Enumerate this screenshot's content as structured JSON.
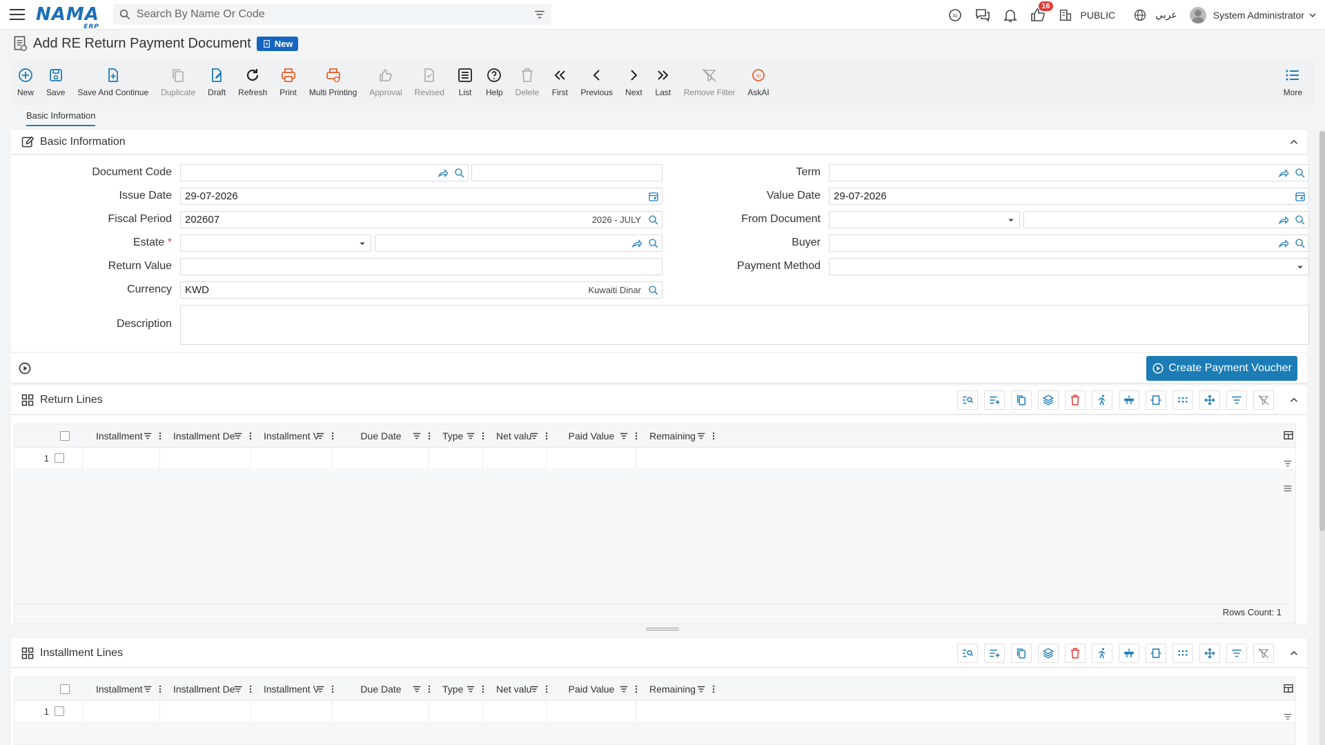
{
  "topbar": {
    "logo": "NAMA",
    "logo_sub": "ERP",
    "search_placeholder": "Search By Name Or Code",
    "notif_count": "16",
    "public_label": "PUBLIC",
    "language": "عربي",
    "user_name": "System Administrator"
  },
  "header": {
    "title": "Add RE Return Payment Document",
    "status": "New"
  },
  "toolbar": [
    {
      "name": "new-button",
      "label": "New",
      "icon": "plus-circle",
      "disabled": false
    },
    {
      "name": "save-button",
      "label": "Save",
      "icon": "save",
      "disabled": false
    },
    {
      "name": "save-and-continue-button",
      "label": "Save And Continue",
      "icon": "doc-plus",
      "disabled": false
    },
    {
      "name": "duplicate-button",
      "label": "Duplicate",
      "icon": "copy",
      "disabled": true
    },
    {
      "name": "draft-button",
      "label": "Draft",
      "icon": "draft",
      "disabled": false
    },
    {
      "name": "refresh-button",
      "label": "Refresh",
      "icon": "refresh",
      "disabled": false
    },
    {
      "name": "print-button",
      "label": "Print",
      "icon": "print",
      "disabled": false
    },
    {
      "name": "multi-printing-button",
      "label": "Multi Printing",
      "icon": "multi-print",
      "disabled": false
    },
    {
      "name": "approval-button",
      "label": "Approval",
      "icon": "thumb",
      "disabled": true
    },
    {
      "name": "revised-button",
      "label": "Revised",
      "icon": "revised",
      "disabled": true
    },
    {
      "name": "list-button",
      "label": "List",
      "icon": "list",
      "disabled": false
    },
    {
      "name": "help-button",
      "label": "Help",
      "icon": "help",
      "disabled": false
    },
    {
      "name": "delete-button",
      "label": "Delete",
      "icon": "trash",
      "disabled": true
    },
    {
      "name": "first-button",
      "label": "First",
      "icon": "first",
      "disabled": false
    },
    {
      "name": "previous-button",
      "label": "Previous",
      "icon": "prev",
      "disabled": false
    },
    {
      "name": "next-button",
      "label": "Next",
      "icon": "next",
      "disabled": false
    },
    {
      "name": "last-button",
      "label": "Last",
      "icon": "last",
      "disabled": false
    },
    {
      "name": "remove-filter-button",
      "label": "Remove Filter",
      "icon": "filter-off",
      "disabled": true
    },
    {
      "name": "askai-button",
      "label": "AskAI",
      "icon": "ai",
      "disabled": false
    }
  ],
  "toolbar_more": "More",
  "tabs": {
    "basic": "Basic Information"
  },
  "basic_panel": {
    "title": "Basic Information",
    "labels": {
      "document_code": "Document Code",
      "issue_date": "Issue Date",
      "fiscal_period": "Fiscal Period",
      "estate": "Estate",
      "return_value": "Return Value",
      "currency": "Currency",
      "description": "Description",
      "term": "Term",
      "value_date": "Value Date",
      "from_document": "From Document",
      "buyer": "Buyer",
      "payment_method": "Payment Method"
    },
    "values": {
      "document_code": "",
      "issue_date": "29-07-2026",
      "fiscal_period": "202607",
      "fiscal_period_hint": "2026 - JULY",
      "estate": "",
      "return_value": "",
      "currency": "KWD",
      "currency_hint": "Kuwaiti Dinar",
      "term": "",
      "value_date": "29-07-2026",
      "from_document": "",
      "buyer": "",
      "payment_method": ""
    },
    "required_mark": "*"
  },
  "action": {
    "create_payment_voucher": "Create Payment Voucher"
  },
  "grid_columns": [
    "Installment Co",
    "Installment Des",
    "Installment Val",
    "Due Date",
    "Type",
    "Net value",
    "Paid Value",
    "Remaining"
  ],
  "return_lines": {
    "title": "Return Lines",
    "row_number": "1",
    "rows_count": "Rows Count: 1"
  },
  "installment_lines": {
    "title": "Installment Lines",
    "row_number": "1"
  },
  "colors": {
    "accent": "#1b7cb6",
    "brand": "#1b6fb8",
    "danger": "#e53935",
    "print": "#e8612c"
  }
}
